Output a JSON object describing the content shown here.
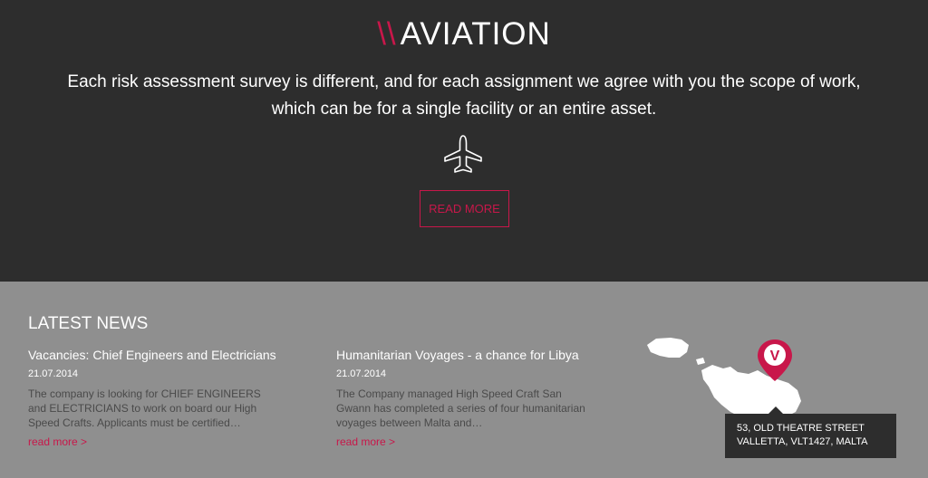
{
  "hero": {
    "slashes": "\\\\",
    "title": "AVIATION",
    "description": "Each risk assessment survey is different, and for each assignment we agree with you the scope of work, which can be for a single facility or an entire asset.",
    "icon": "airplane-icon",
    "read_more": "READ MORE"
  },
  "news": {
    "heading": "LATEST NEWS",
    "items": [
      {
        "title": "Vacancies: Chief Engineers and Electricians",
        "date": "21.07.2014",
        "excerpt": "The company is looking for CHIEF ENGINEERS and ELECTRICIANS to work on board our High Speed Crafts. Applicants must be certified…",
        "more": "read more >"
      },
      {
        "title": "Humanitarian Voyages - a chance for Libya",
        "date": "21.07.2014",
        "excerpt": "The Company managed High Speed Craft San Gwann has completed a series of four humanitarian voyages between Malta and…",
        "more": "read more >"
      }
    ]
  },
  "map": {
    "pin_letter": "V",
    "address_line1": "53, OLD THEATRE STREET",
    "address_line2": "VALLETTA, VLT1427, MALTA"
  },
  "colors": {
    "accent": "#c8174a",
    "dark_bg": "#2d2d2d",
    "news_bg": "#8f8f8f"
  }
}
